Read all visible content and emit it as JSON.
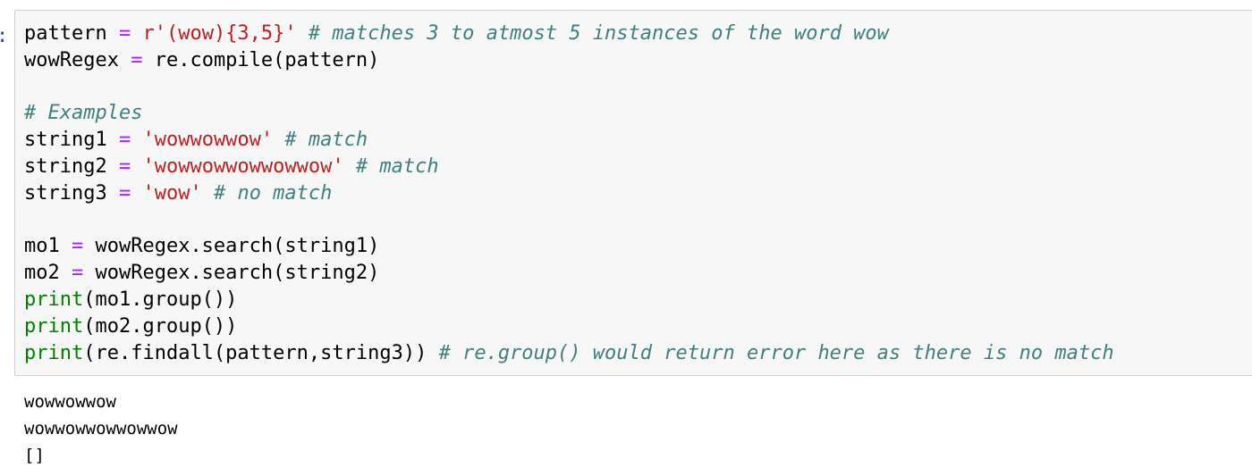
{
  "cell": {
    "prompt_marker": ":",
    "code_lines": [
      [
        {
          "t": "txt",
          "v": "pattern "
        },
        {
          "t": "op",
          "v": "="
        },
        {
          "t": "txt",
          "v": " "
        },
        {
          "t": "str",
          "v": "r'(wow){3,5}'"
        },
        {
          "t": "txt",
          "v": " "
        },
        {
          "t": "com",
          "v": "# matches 3 to atmost 5 instances of the word wow"
        }
      ],
      [
        {
          "t": "txt",
          "v": "wowRegex "
        },
        {
          "t": "op",
          "v": "="
        },
        {
          "t": "txt",
          "v": " re.compile(pattern)"
        }
      ],
      [],
      [
        {
          "t": "com",
          "v": "# Examples"
        }
      ],
      [
        {
          "t": "txt",
          "v": "string1 "
        },
        {
          "t": "op",
          "v": "="
        },
        {
          "t": "txt",
          "v": " "
        },
        {
          "t": "str",
          "v": "'wowwowwow'"
        },
        {
          "t": "txt",
          "v": " "
        },
        {
          "t": "com",
          "v": "# match"
        }
      ],
      [
        {
          "t": "txt",
          "v": "string2 "
        },
        {
          "t": "op",
          "v": "="
        },
        {
          "t": "txt",
          "v": " "
        },
        {
          "t": "str",
          "v": "'wowwowwowwowwow'"
        },
        {
          "t": "txt",
          "v": " "
        },
        {
          "t": "com",
          "v": "# match"
        }
      ],
      [
        {
          "t": "txt",
          "v": "string3 "
        },
        {
          "t": "op",
          "v": "="
        },
        {
          "t": "txt",
          "v": " "
        },
        {
          "t": "str",
          "v": "'wow'"
        },
        {
          "t": "txt",
          "v": " "
        },
        {
          "t": "com",
          "v": "# no match"
        }
      ],
      [],
      [
        {
          "t": "txt",
          "v": "mo1 "
        },
        {
          "t": "op",
          "v": "="
        },
        {
          "t": "txt",
          "v": " wowRegex.search(string1)"
        }
      ],
      [
        {
          "t": "txt",
          "v": "mo2 "
        },
        {
          "t": "op",
          "v": "="
        },
        {
          "t": "txt",
          "v": " wowRegex.search(string2)"
        }
      ],
      [
        {
          "t": "bi",
          "v": "print"
        },
        {
          "t": "txt",
          "v": "(mo1.group())"
        }
      ],
      [
        {
          "t": "bi",
          "v": "print"
        },
        {
          "t": "txt",
          "v": "(mo2.group())"
        }
      ],
      [
        {
          "t": "bi",
          "v": "print"
        },
        {
          "t": "txt",
          "v": "(re.findall(pattern,string3)) "
        },
        {
          "t": "com",
          "v": "# re.group() would return error here as there is no match"
        }
      ]
    ],
    "output_lines": [
      "wowwowwow",
      "wowwowwowwowwow",
      "[]"
    ]
  },
  "colors": {
    "code_background": "#f7f7f7",
    "cell_border": "#cfcfcf",
    "operator": "#aa22ff",
    "string": "#ba2121",
    "comment": "#408080",
    "builtin": "#008000"
  }
}
